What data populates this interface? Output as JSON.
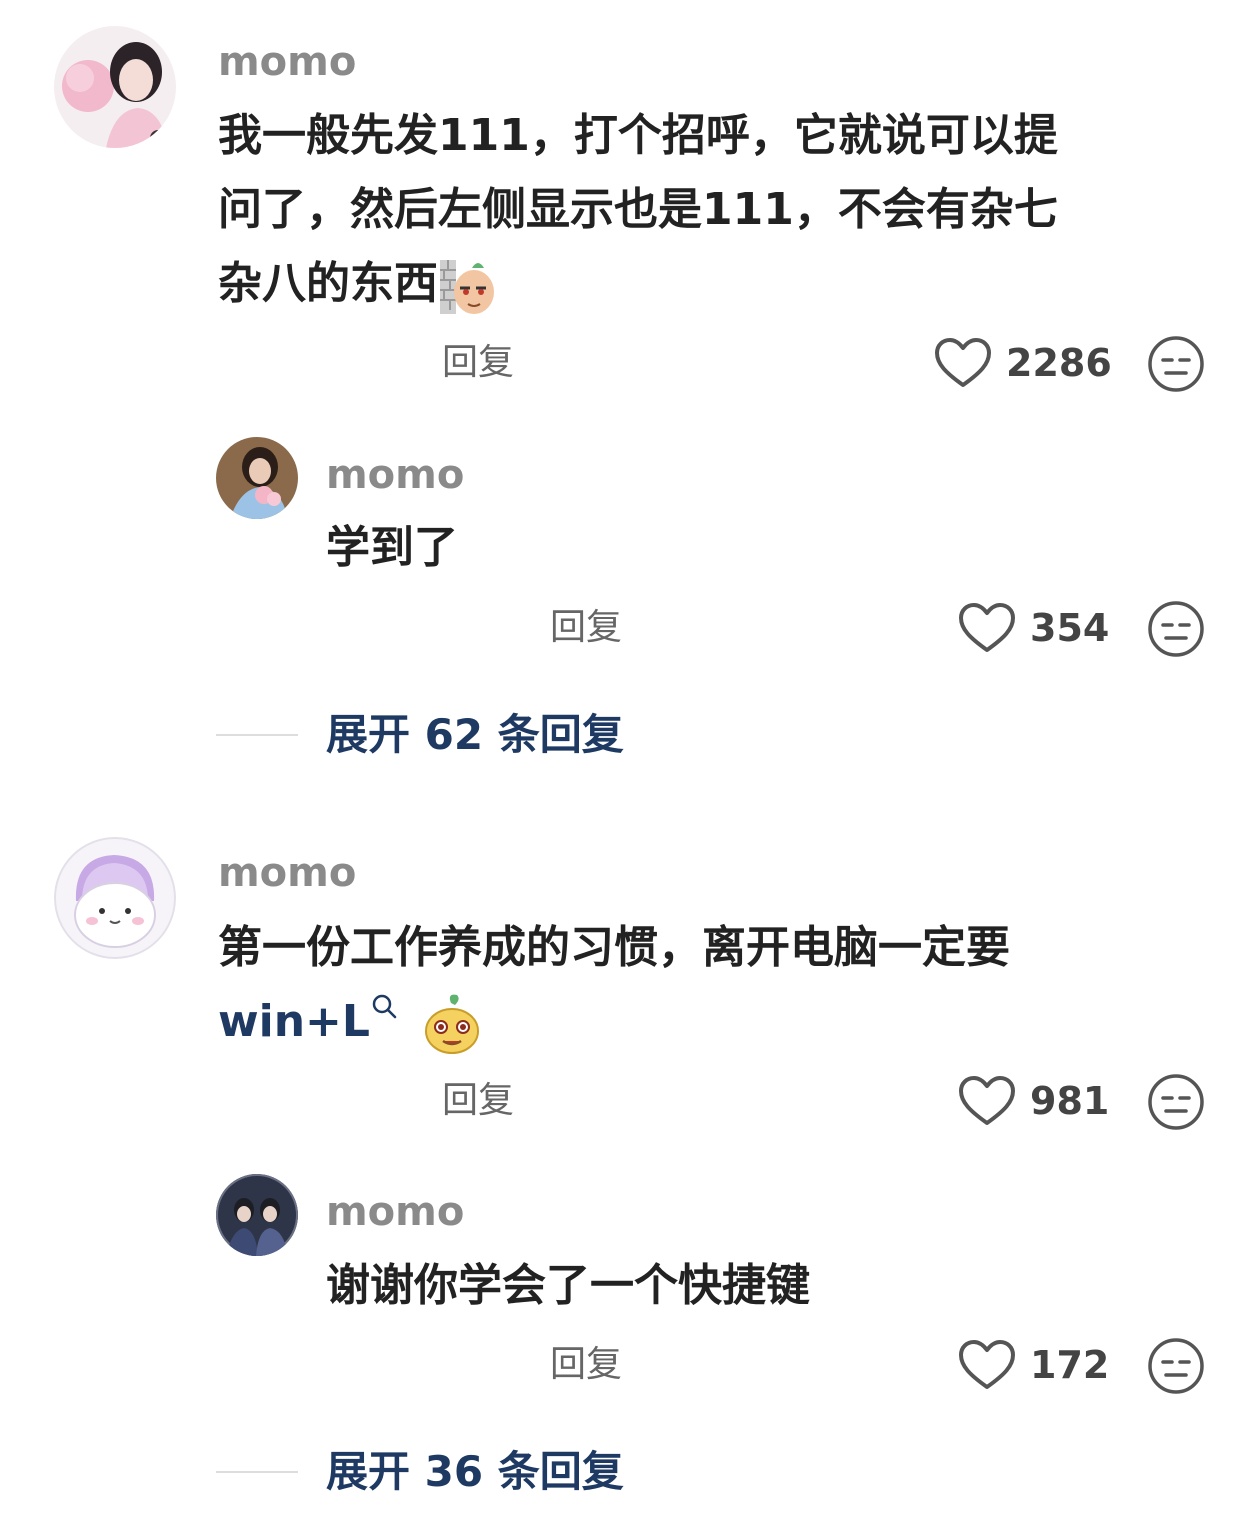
{
  "comments": [
    {
      "username": "momo",
      "text": "我一般先发111，打个招呼，它就说可以提问了，然后左侧显示也是111，不会有杂七杂八的东西",
      "line1": "我一般先发111，打个招呼，它就说可以提",
      "line2": "问了，然后左侧显示也是111，不会有杂七",
      "line3": "杂八的东西",
      "reply_label": "回复",
      "likes": "2286",
      "replies": [
        {
          "username": "momo",
          "text": "学到了",
          "reply_label": "回复",
          "likes": "354"
        }
      ],
      "expand_label": "展开 62 条回复"
    },
    {
      "username": "momo",
      "line1": "第一份工作养成的习惯，离开电脑一定要",
      "link_text": "win+L",
      "reply_label": "回复",
      "likes": "981",
      "replies": [
        {
          "username": "momo",
          "text": "谢谢你学会了一个快捷键",
          "reply_label": "回复",
          "likes": "172"
        }
      ],
      "expand_label": "展开 36 条回复"
    }
  ],
  "icons": {
    "like": "heart-outline-icon",
    "dislike": "meh-face-icon",
    "search": "search-icon"
  },
  "colors": {
    "link": "#1e3a63",
    "username": "#8a8a8a",
    "text": "#222222"
  }
}
